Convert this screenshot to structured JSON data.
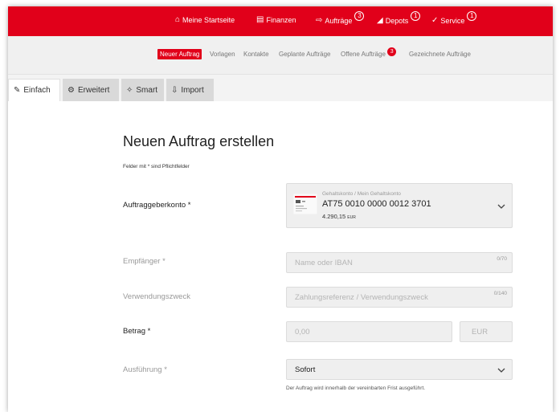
{
  "topnav": {
    "items": [
      {
        "label": "Meine Startseite",
        "icon": "home-icon",
        "badge": ""
      },
      {
        "label": "Finanzen",
        "icon": "finance-icon",
        "badge": ""
      },
      {
        "label": "Aufträge",
        "icon": "orders-icon",
        "badge": "3"
      },
      {
        "label": "Depots",
        "icon": "chart-icon",
        "badge": "1"
      },
      {
        "label": "Service",
        "icon": "service-icon",
        "badge": "1"
      }
    ]
  },
  "subnav": {
    "items": [
      {
        "label": "Neuer Auftrag",
        "active": true
      },
      {
        "label": "Vorlagen"
      },
      {
        "label": "Kontakte"
      },
      {
        "label": "Geplante Aufträge"
      },
      {
        "label": "Offene Aufträge",
        "badge": "3"
      },
      {
        "label": "Gezeichnete Aufträge"
      }
    ]
  },
  "tabs": [
    {
      "label": "Einfach",
      "icon": "edit-icon",
      "active": true
    },
    {
      "label": "Erweitert",
      "icon": "settings-icon"
    },
    {
      "label": "Smart",
      "icon": "magic-icon"
    },
    {
      "label": "Import",
      "icon": "import-icon"
    }
  ],
  "form": {
    "title": "Neuen Auftrag erstellen",
    "required_note": "Felder mit * sind Pflichtfelder",
    "account": {
      "label": "Auftraggeberkonto *",
      "name": "Gehaltskonto / Mein Gehaltskonto",
      "iban": "AT75 0010 0000 0012 3701",
      "balance": "4.290,15",
      "currency": "EUR"
    },
    "recipient": {
      "label": "Empfänger *",
      "placeholder": "Name oder IBAN",
      "counter": "0/70"
    },
    "purpose": {
      "label": "Verwendungszweck",
      "placeholder": "Zahlungsreferenz / Verwendungszweck",
      "counter": "0/140"
    },
    "amount": {
      "label": "Betrag *",
      "placeholder": "0,00",
      "currency": "EUR"
    },
    "execution": {
      "label": "Ausführung *",
      "value": "Sofort",
      "hint": "Der Auftrag wird innerhalb der vereinbarten Frist ausgeführt."
    }
  },
  "colors": {
    "brand": "#e1001a"
  }
}
